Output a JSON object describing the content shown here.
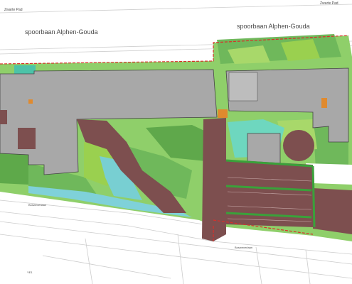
{
  "map": {
    "labels": {
      "top_left_small": "Zwarte Pad",
      "top_right_small": "Zwarte Pad",
      "railway_left": "spoorbaan Alphen-Gouda",
      "railway_right": "spoorbaan Alphen-Gouda",
      "street_left": "Bosweverlaan",
      "street_right": "Bosweverlaan",
      "corner_code": "YE1"
    },
    "colors": {
      "building": "#a8a8a8",
      "paving_dark": "#7d4f4f",
      "grass": "#6fb85b",
      "grass_light": "#a8d86a",
      "water": "#7fd1d9",
      "road_line": "#d0d0d0",
      "boundary": "#d9302a"
    }
  }
}
